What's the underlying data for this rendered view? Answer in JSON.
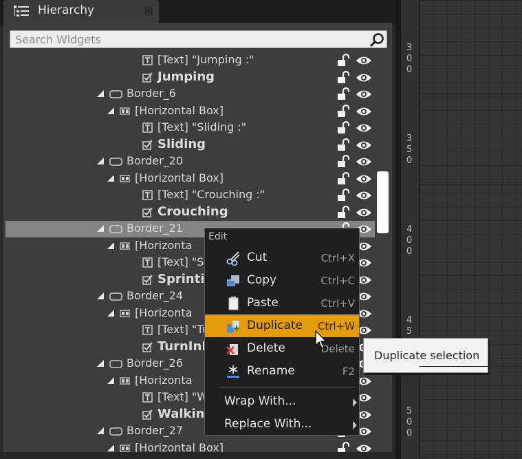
{
  "panel": {
    "title": "Hierarchy",
    "search_placeholder": "Search Widgets"
  },
  "tree": [
    {
      "label": "[Text] \"Jumping :\"",
      "type": "text",
      "bold": false
    },
    {
      "label": "Jumping",
      "type": "checkbox",
      "bold": true
    },
    {
      "label": "Border_6",
      "type": "border",
      "bold": false,
      "expanded": true
    },
    {
      "label": "[Horizontal Box]",
      "type": "hbox",
      "bold": false,
      "expanded": true
    },
    {
      "label": "[Text] \"Sliding :\"",
      "type": "text",
      "bold": false
    },
    {
      "label": "Sliding",
      "type": "checkbox",
      "bold": true
    },
    {
      "label": "Border_20",
      "type": "border",
      "bold": false,
      "expanded": true
    },
    {
      "label": "[Horizontal Box]",
      "type": "hbox",
      "bold": false,
      "expanded": true
    },
    {
      "label": "[Text] \"Crouching :\"",
      "type": "text",
      "bold": false
    },
    {
      "label": "Crouching",
      "type": "checkbox",
      "bold": true
    },
    {
      "label": "Border_21",
      "type": "border",
      "bold": false,
      "expanded": true,
      "selected": true
    },
    {
      "label": "[Horizonta",
      "type": "hbox",
      "bold": false,
      "expanded": true
    },
    {
      "label": "[Text] \"Sp",
      "type": "text",
      "bold": false
    },
    {
      "label": "Sprintin",
      "type": "checkbox",
      "bold": true
    },
    {
      "label": "Border_24",
      "type": "border",
      "bold": false,
      "expanded": true
    },
    {
      "label": "[Horizonta",
      "type": "hbox",
      "bold": false,
      "expanded": true
    },
    {
      "label": "[Text] \"Tu",
      "type": "text",
      "bold": false
    },
    {
      "label": "TurnInP",
      "type": "checkbox",
      "bold": true
    },
    {
      "label": "Border_26",
      "type": "border",
      "bold": false,
      "expanded": true
    },
    {
      "label": "[Horizonta",
      "type": "hbox",
      "bold": false,
      "expanded": true
    },
    {
      "label": "[Text] \"W",
      "type": "text",
      "bold": false
    },
    {
      "label": "Walking",
      "type": "checkbox",
      "bold": true
    },
    {
      "label": "Border_27",
      "type": "border",
      "bold": false,
      "expanded": true
    },
    {
      "label": "[Horizontal Box]",
      "type": "hbox",
      "bold": false,
      "expanded": true
    }
  ],
  "context_menu": {
    "header": "Edit",
    "items": [
      {
        "label": "Cut",
        "shortcut": "Ctrl+X",
        "icon": "scissors-icon"
      },
      {
        "label": "Copy",
        "shortcut": "Ctrl+C",
        "icon": "copy-icon"
      },
      {
        "label": "Paste",
        "shortcut": "Ctrl+V",
        "icon": "paste-icon"
      },
      {
        "label": "Duplicate",
        "shortcut": "Ctrl+W",
        "icon": "duplicate-icon",
        "highlighted": true
      },
      {
        "label": "Delete",
        "shortcut": "Delete",
        "icon": "delete-icon"
      },
      {
        "label": "Rename",
        "shortcut": "F2",
        "icon": "rename-icon"
      }
    ],
    "submenus": [
      {
        "label": "Wrap With..."
      },
      {
        "label": "Replace With..."
      }
    ]
  },
  "tooltip": "Duplicate selection",
  "ruler": {
    "labels": [
      "300",
      "350",
      "400",
      "450",
      "500"
    ]
  },
  "colors": {
    "highlight": "#e39a0b",
    "selected_row": "#848484"
  }
}
